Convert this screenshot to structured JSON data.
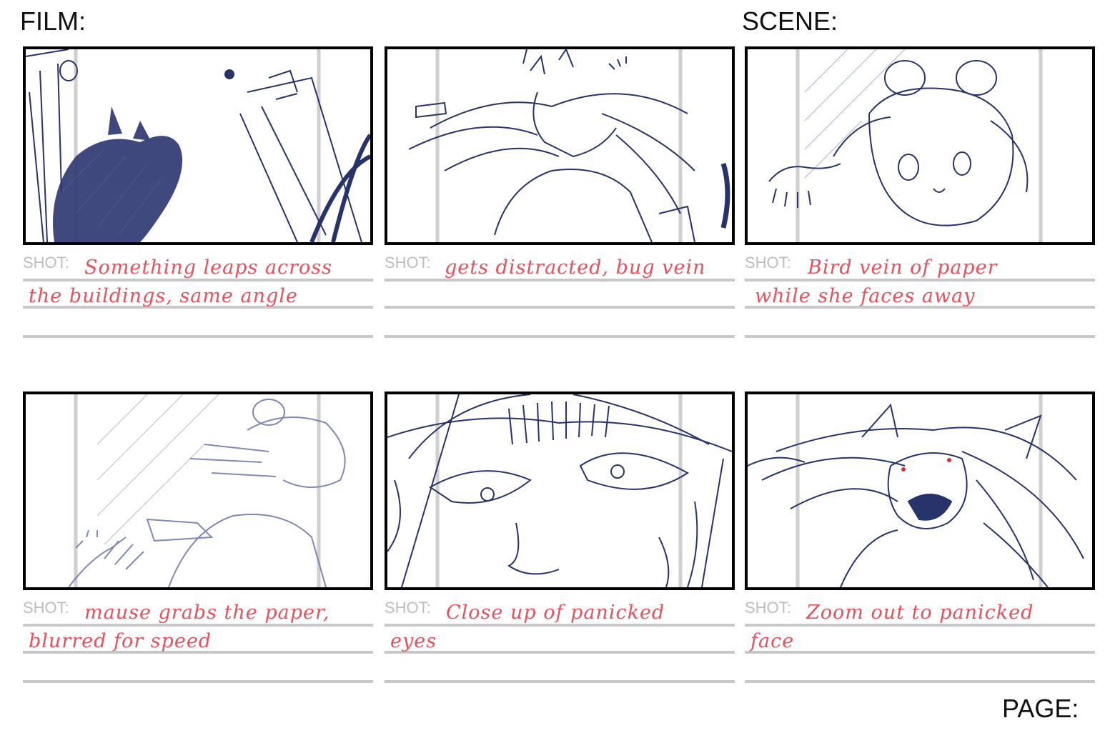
{
  "header": {
    "film_label": "FILM:",
    "scene_label": "SCENE:",
    "page_label": "PAGE:"
  },
  "colors": {
    "sketch_ink": "#27336b",
    "note_ink": "#e8505b",
    "guide_gray": "#c8c8c8"
  },
  "panels": [
    {
      "shot_label": "SHOT:",
      "line1": "Something leaps across",
      "line2": "the buildings, same angle"
    },
    {
      "shot_label": "SHOT:",
      "line1": "gets distracted, bug vein",
      "line2": ""
    },
    {
      "shot_label": "SHOT:",
      "line1": "Bird vein of paper",
      "line2": "while she faces away"
    },
    {
      "shot_label": "SHOT:",
      "line1": "mause grabs the paper,",
      "line2": "blurred for speed"
    },
    {
      "shot_label": "SHOT:",
      "line1": "Close up of panicked",
      "line2": "eyes"
    },
    {
      "shot_label": "SHOT:",
      "line1": "Zoom out to panicked",
      "line2": "face"
    }
  ]
}
